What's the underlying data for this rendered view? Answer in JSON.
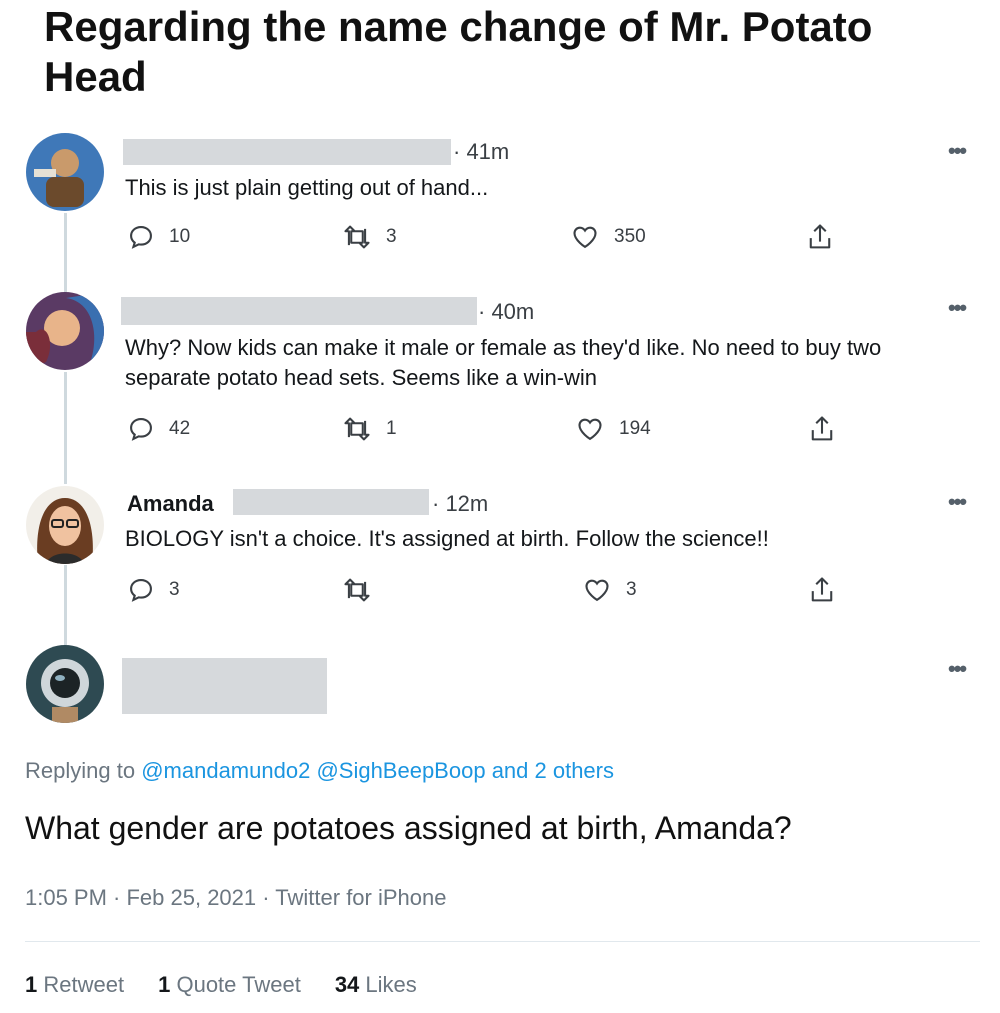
{
  "headline": "Regarding the name change of Mr. Potato Head",
  "colors": {
    "text": "#14171a",
    "muted": "#6b7680",
    "link": "#1b95e0",
    "redaction": "#d6d9dc"
  },
  "tweets": [
    {
      "name": "",
      "time": "· 41m",
      "text": "This is just plain getting out of hand...",
      "replies": "10",
      "retweets": "3",
      "likes": "350"
    },
    {
      "name": "",
      "time": "· 40m",
      "text": "Why? Now kids can make it male or female as they'd like. No need to buy two separate potato head sets. Seems like a win-win",
      "replies": "42",
      "retweets": "1",
      "likes": "194"
    },
    {
      "name": "Amanda",
      "time": "· 12m",
      "text": "BIOLOGY isn't a choice. It's assigned at birth. Follow the science!!",
      "replies": "3",
      "retweets": "",
      "likes": "3"
    }
  ],
  "main_tweet": {
    "replying_prefix": "Replying to",
    "mention_1": "@mandamundo2",
    "mention_2": "@SighBeepBoop",
    "others": "and 2 others",
    "text": "What gender are potatoes assigned at birth, Amanda?",
    "timestamp": "1:05 PM · Feb 25, 2021 · Twitter for iPhone",
    "stats": {
      "retweets_count": "1",
      "retweets_label": "Retweet",
      "quotes_count": "1",
      "quotes_label": "Quote Tweet",
      "likes_count": "34",
      "likes_label": "Likes"
    }
  },
  "more_glyph": "•••",
  "icons": [
    "reply-icon",
    "retweet-icon",
    "like-icon",
    "share-icon",
    "more-icon"
  ]
}
